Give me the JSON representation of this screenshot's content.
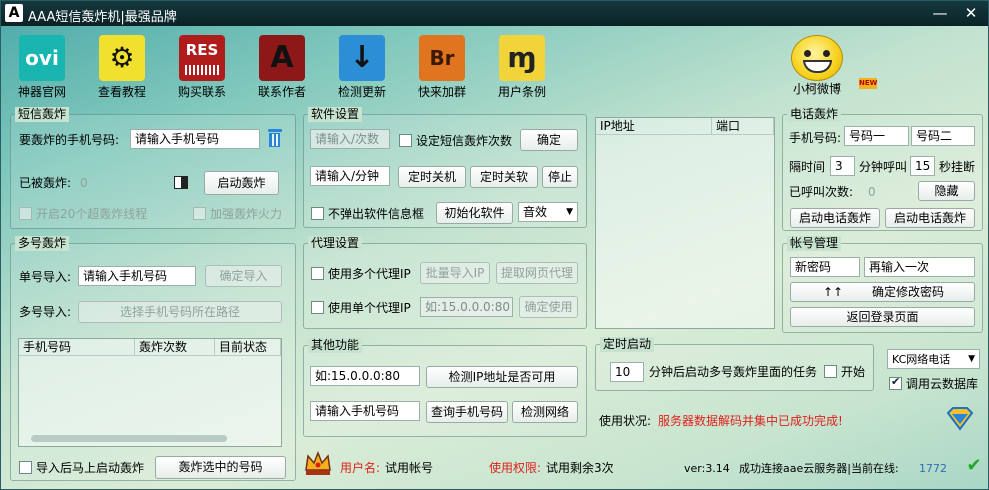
{
  "window": {
    "title": "AAA短信轰炸机|最强品牌",
    "logo": "A",
    "minimize": "—",
    "close": "✕"
  },
  "toolbar": [
    {
      "label": "神器官网",
      "icon": "ovi",
      "color": "#19b5b0"
    },
    {
      "label": "查看教程",
      "icon": "⚙",
      "color": "#f2e02e"
    },
    {
      "label": "购买联系",
      "icon": "RES",
      "color": "#b01c1c"
    },
    {
      "label": "联系作者",
      "icon": "A",
      "color": "#8e1818"
    },
    {
      "label": "检测更新",
      "icon": "↓",
      "color": "#2c8fd6"
    },
    {
      "label": "快来加群",
      "icon": "Br",
      "color": "#e1741e"
    },
    {
      "label": "用户条例",
      "icon": "ɱ",
      "color": "#f0d43a"
    }
  ],
  "weibo": {
    "label": "小柯微博",
    "badge": "NEW"
  },
  "sms_bomb": {
    "title": "短信轰炸",
    "phone_label": "要轰炸的手机号码:",
    "phone_value": "请输入手机号码",
    "bombed_label": "已被轰炸:",
    "bombed_count": "0",
    "start_btn": "启动轰炸",
    "opt_threads": "开启20个超轰炸线程",
    "opt_fire": "加强轰炸火力"
  },
  "multi_bomb": {
    "title": "多号轰炸",
    "single_label": "单号导入:",
    "single_value": "请输入手机号码",
    "confirm_btn": "确定导入",
    "multi_label": "多号导入:",
    "path_btn": "选择手机号码所在路径",
    "columns": [
      "手机号码",
      "轰炸次数",
      "目前状态"
    ],
    "auto_start": "导入后马上启动轰炸",
    "bomb_selected_btn": "轰炸选中的号码"
  },
  "software_settings": {
    "title": "软件设置",
    "times_value": "请输入/次数",
    "set_times_label": "设定短信轰炸次数",
    "confirm_btn": "确定",
    "minutes_value": "请输入/分钟",
    "shutdown_btn": "定时关机",
    "close_btn": "定时关软",
    "stop_btn": "停止",
    "no_popup_label": "不弹出软件信息框",
    "init_btn": "初始化软件",
    "sound_select": "音效"
  },
  "proxy_settings": {
    "title": "代理设置",
    "multi_label": "使用多个代理IP",
    "batch_btn": "批量导入IP",
    "extract_btn": "提取网页代理",
    "single_label": "使用单个代理IP",
    "ip_value": "如:15.0.0.0:80",
    "use_btn": "确定使用"
  },
  "other_functions": {
    "title": "其他功能",
    "ip_value": "如:15.0.0.0:80",
    "check_ip_btn": "检测IP地址是否可用",
    "phone_value": "请输入手机号码",
    "query_phone_btn": "查询手机号码",
    "check_network_btn": "检测网络"
  },
  "ip_list": {
    "columns": [
      "IP地址",
      "端口"
    ]
  },
  "timer": {
    "title": "定时启动",
    "minutes": "10",
    "desc": "分钟后启动多号轰炸里面的任务",
    "start_label": "开始"
  },
  "network_select": "KC网络电话",
  "cloud_db": "调用云数据库",
  "status": {
    "label": "使用状况:",
    "message": "服务器数据解码并集中已成功完成!"
  },
  "phone_bomb": {
    "title": "电话轰炸",
    "phone_label": "手机号码:",
    "phone1": "号码一",
    "phone2": "号码二",
    "interval_label": "隔时间",
    "interval": "3",
    "call_label": "分钟呼叫",
    "hangup": "15",
    "hangup_label": "秒挂断",
    "called_label": "已呼叫次数:",
    "called_count": "0",
    "hide_btn": "隐藏",
    "start_btn1": "启动电话轰炸",
    "start_btn2": "启动电话轰炸"
  },
  "account": {
    "title": "帐号管理",
    "new_pwd": "新密码",
    "repeat_pwd": "再输入一次",
    "arrows": "↑↑",
    "confirm_btn": "确定修改密码",
    "back_btn": "返回登录页面"
  },
  "footer": {
    "user_label": "用户名:",
    "user_value": "试用帐号",
    "perm_label": "使用权限:",
    "perm_value": "试用剩余3次",
    "version": "ver:3.14",
    "conn_text": "成功连接aae云服务器|当前在线:",
    "online": "1772"
  }
}
